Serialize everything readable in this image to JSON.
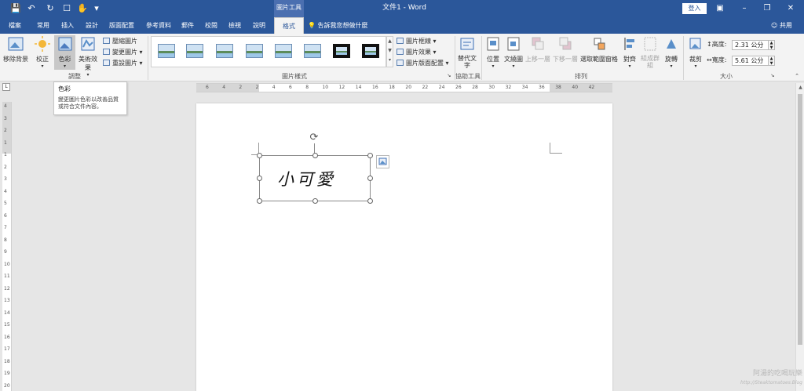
{
  "titlebar": {
    "document_title": "文件1 - Word",
    "context_tools_label": "圖片工具",
    "login_label": "登入"
  },
  "tabs": [
    {
      "label": "檔案"
    },
    {
      "label": "常用"
    },
    {
      "label": "插入"
    },
    {
      "label": "設計"
    },
    {
      "label": "版面配置"
    },
    {
      "label": "參考資料"
    },
    {
      "label": "郵件"
    },
    {
      "label": "校閱"
    },
    {
      "label": "檢視"
    },
    {
      "label": "說明"
    },
    {
      "label": "格式"
    }
  ],
  "tell_me": "告訴我您想做什麼",
  "share_label": "共用",
  "ribbon": {
    "remove_bg": "移除背景",
    "corrections": "校正",
    "color": "色彩",
    "artistic": "美術效果",
    "compress": "壓縮圖片",
    "change_picture": "變更圖片",
    "reset_picture": "重設圖片",
    "group_adjust": "調整",
    "border": "圖片框線",
    "effects": "圖片效果",
    "layout": "圖片版面配置",
    "group_styles": "圖片樣式",
    "alt_text": "替代文字",
    "group_accessibility": "協助工具",
    "position": "位置",
    "wrap_text": "文繞圖",
    "bring_forward": "上移一層",
    "send_backward": "下移一層",
    "selection_pane": "選取範圍窗格",
    "align": "對齊",
    "group_obj": "組成群組",
    "rotate": "旋轉",
    "group_arrange": "排列",
    "crop": "裁剪",
    "height_label": "高度:",
    "height_value": "2.31 公分",
    "width_label": "寬度:",
    "width_value": "5.61 公分",
    "group_size": "大小"
  },
  "tooltip": {
    "title": "色彩",
    "description": "變更圖片色彩以改善品質或符合文件內容。"
  },
  "hruler": [
    "6",
    "4",
    "2",
    "2",
    "4",
    "6",
    "8",
    "10",
    "12",
    "14",
    "16",
    "18",
    "20",
    "22",
    "24",
    "26",
    "28",
    "30",
    "32",
    "34",
    "36",
    "38",
    "40",
    "42"
  ],
  "vruler": [
    "4",
    "3",
    "2",
    "1",
    "1",
    "2",
    "3",
    "4",
    "5",
    "6",
    "7",
    "8",
    "9",
    "10",
    "11",
    "12",
    "13",
    "14",
    "15",
    "16",
    "17",
    "18",
    "19",
    "20"
  ],
  "picture_text": "小可愛",
  "watermark": {
    "line1": "阿湯的吃喝玩樂",
    "line2": "http://Steaktomatoes.Blog"
  }
}
